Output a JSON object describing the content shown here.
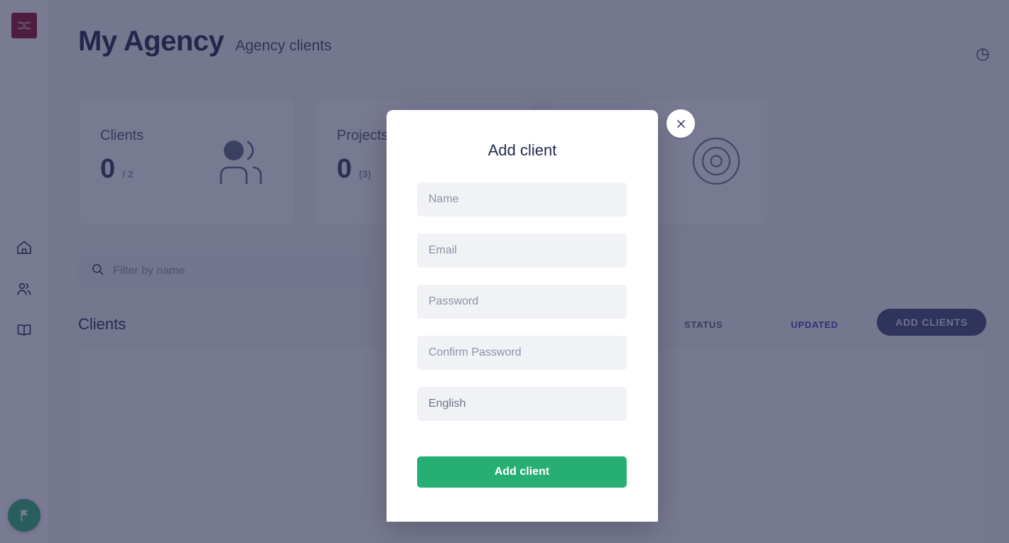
{
  "app": {
    "logo_icon": "dc-monogram-logo-icon",
    "logo_color": "#8b0020",
    "accent_green": "#27ae72",
    "accent_blue": "#3b3bbf",
    "overlay_color": "#64647c"
  },
  "sidebar": {
    "items": [
      {
        "icon": "home-icon",
        "name": "sidebar-item-home"
      },
      {
        "icon": "users-icon",
        "name": "sidebar-item-clients"
      },
      {
        "icon": "book-icon",
        "name": "sidebar-item-knowledge"
      }
    ],
    "fab": {
      "icon": "flag-icon",
      "label": ""
    }
  },
  "header": {
    "title": "My Agency",
    "subtitle": "Agency clients",
    "action_icon": "pie-chart-icon"
  },
  "stat_cards": [
    {
      "label": "Clients",
      "value": "0",
      "extra": "/ 2",
      "icon": "people-icon"
    },
    {
      "label": "Projects",
      "value": "0",
      "extra": "(3)",
      "icon": "folder-icon"
    },
    {
      "label": "",
      "value": "",
      "extra": "",
      "icon": "target-icon"
    }
  ],
  "filter": {
    "icon": "search-icon",
    "placeholder": "Filter by name",
    "value": ""
  },
  "table": {
    "title": "Clients",
    "columns": [
      {
        "label": "STATUS",
        "accent": false
      },
      {
        "label": "UPDATED",
        "accent": true
      }
    ],
    "add_button": "ADD CLIENTS",
    "rows": []
  },
  "modal": {
    "title": "Add client",
    "close_icon": "close-icon",
    "fields": [
      {
        "name": "name-field",
        "placeholder": "Name",
        "value": "",
        "type": "text"
      },
      {
        "name": "email-field",
        "placeholder": "Email",
        "value": "",
        "type": "text"
      },
      {
        "name": "password-field",
        "placeholder": "Password",
        "value": "",
        "type": "password"
      },
      {
        "name": "confirm-password-field",
        "placeholder": "Confirm Password",
        "value": "",
        "type": "password"
      }
    ],
    "language_select": {
      "selected": "English",
      "chevron_icon": "chevron-down-icon"
    },
    "submit_label": "Add client"
  }
}
